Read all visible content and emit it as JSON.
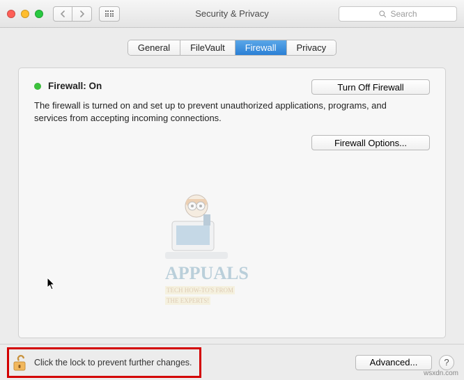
{
  "window": {
    "title": "Security & Privacy"
  },
  "toolbar": {
    "search_placeholder": "Search"
  },
  "tabs": {
    "general": "General",
    "filevault": "FileVault",
    "firewall": "Firewall",
    "privacy": "Privacy"
  },
  "firewall": {
    "status_label": "Firewall: On",
    "turn_off": "Turn Off Firewall",
    "description": "The firewall is turned on and set up to prevent unauthorized applications, programs, and services from accepting incoming connections.",
    "options": "Firewall Options..."
  },
  "footer": {
    "lock_text": "Click the lock to prevent further changes.",
    "advanced": "Advanced...",
    "help": "?"
  },
  "watermark": {
    "brand": "APPUALS",
    "tag1": "TECH HOW-TO'S FROM",
    "tag2": "THE EXPERTS!",
    "site": "wsxdn.com"
  }
}
